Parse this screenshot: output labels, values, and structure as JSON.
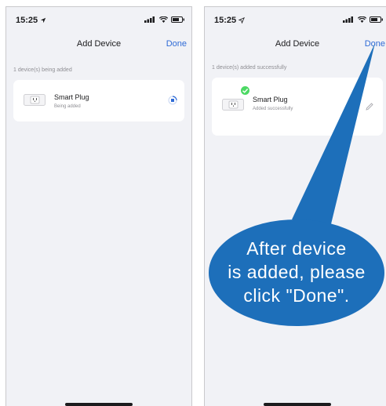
{
  "left_screen": {
    "status_time": "15:25",
    "nav_title": "Add Device",
    "done_label": "Done",
    "section_label": "1 device(s) being added",
    "device": {
      "name": "Smart Plug",
      "status": "Being added"
    }
  },
  "right_screen": {
    "status_time": "15:25",
    "nav_title": "Add Device",
    "done_label": "Done",
    "section_label": "1 device(s) added successfully",
    "device": {
      "name": "Smart Plug",
      "status": "Added successfully"
    }
  },
  "callout": {
    "lines": [
      "After device",
      "is added, please",
      "click \"Done\"."
    ],
    "color": "#1d6fba"
  },
  "colors": {
    "accent": "#2f6bd6",
    "success": "#4cd964",
    "background": "#f1f2f6"
  },
  "icons": [
    "location-arrow-icon",
    "signal-icon",
    "wifi-icon",
    "battery-icon",
    "smart-plug-icon",
    "loading-spinner-icon",
    "success-check-icon",
    "edit-icon"
  ]
}
